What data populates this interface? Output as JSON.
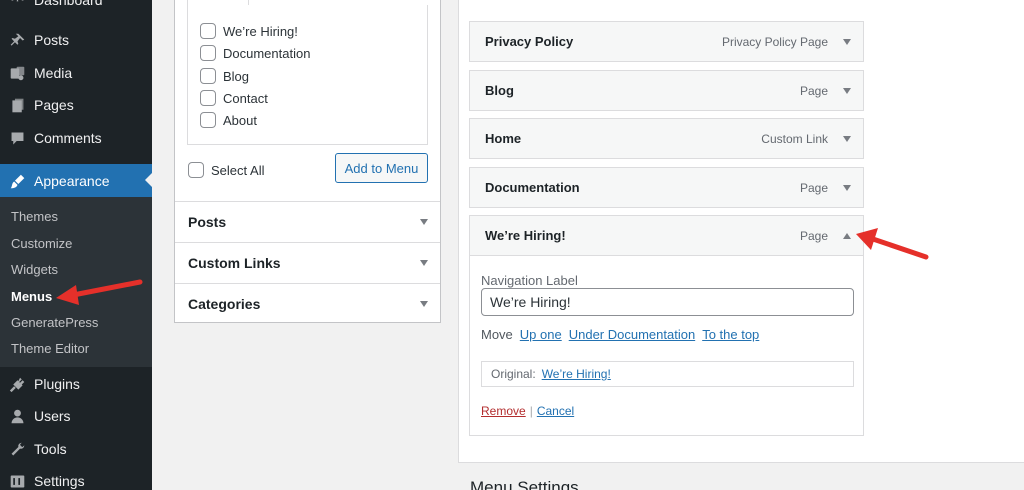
{
  "sidebar": {
    "top_partial_label": "Dashboard",
    "items_top": [
      {
        "label": "Posts",
        "icon": "pin-icon"
      },
      {
        "label": "Media",
        "icon": "media-icon"
      },
      {
        "label": "Pages",
        "icon": "pages-icon"
      },
      {
        "label": "Comments",
        "icon": "comments-icon"
      },
      {
        "label": "Appearance",
        "icon": "paintbrush-icon"
      }
    ],
    "submenu": [
      "Themes",
      "Customize",
      "Widgets",
      "Menus",
      "GeneratePress",
      "Theme Editor"
    ],
    "current_submenu": "Menus",
    "items_bottom": [
      {
        "label": "Plugins",
        "icon": "plugin-icon"
      },
      {
        "label": "Users",
        "icon": "users-icon"
      },
      {
        "label": "Tools",
        "icon": "wrench-icon"
      },
      {
        "label": "Settings",
        "icon": "settings-icon"
      }
    ]
  },
  "add_items": {
    "pages": [
      "We’re Hiring!",
      "Documentation",
      "Blog",
      "Contact",
      "About"
    ],
    "select_all_label": "Select All",
    "add_button_label": "Add to Menu",
    "sections": [
      "Posts",
      "Custom Links",
      "Categories"
    ]
  },
  "menu_structure": {
    "items": [
      {
        "title": "Privacy Policy",
        "type": "Privacy Policy Page",
        "expanded": false
      },
      {
        "title": "Blog",
        "type": "Page",
        "expanded": false
      },
      {
        "title": "Home",
        "type": "Custom Link",
        "expanded": false
      },
      {
        "title": "Documentation",
        "type": "Page",
        "expanded": false
      },
      {
        "title": "We’re Hiring!",
        "type": "Page",
        "expanded": true
      }
    ],
    "settings": {
      "nav_label_caption": "Navigation Label",
      "nav_label_value": "We’re Hiring!",
      "move_label": "Move",
      "move_links": [
        "Up one",
        "Under Documentation",
        "To the top"
      ],
      "original_label": "Original:",
      "original_link": "We’re Hiring!",
      "remove_label": "Remove",
      "separator": "|",
      "cancel_label": "Cancel"
    }
  },
  "menu_settings_heading": "Menu Settings",
  "colors": {
    "sidebar_bg": "#1d2327",
    "active_bg": "#2271b1",
    "link": "#2271b1",
    "remove": "#b32d2e",
    "annotation": "#e5302a"
  }
}
